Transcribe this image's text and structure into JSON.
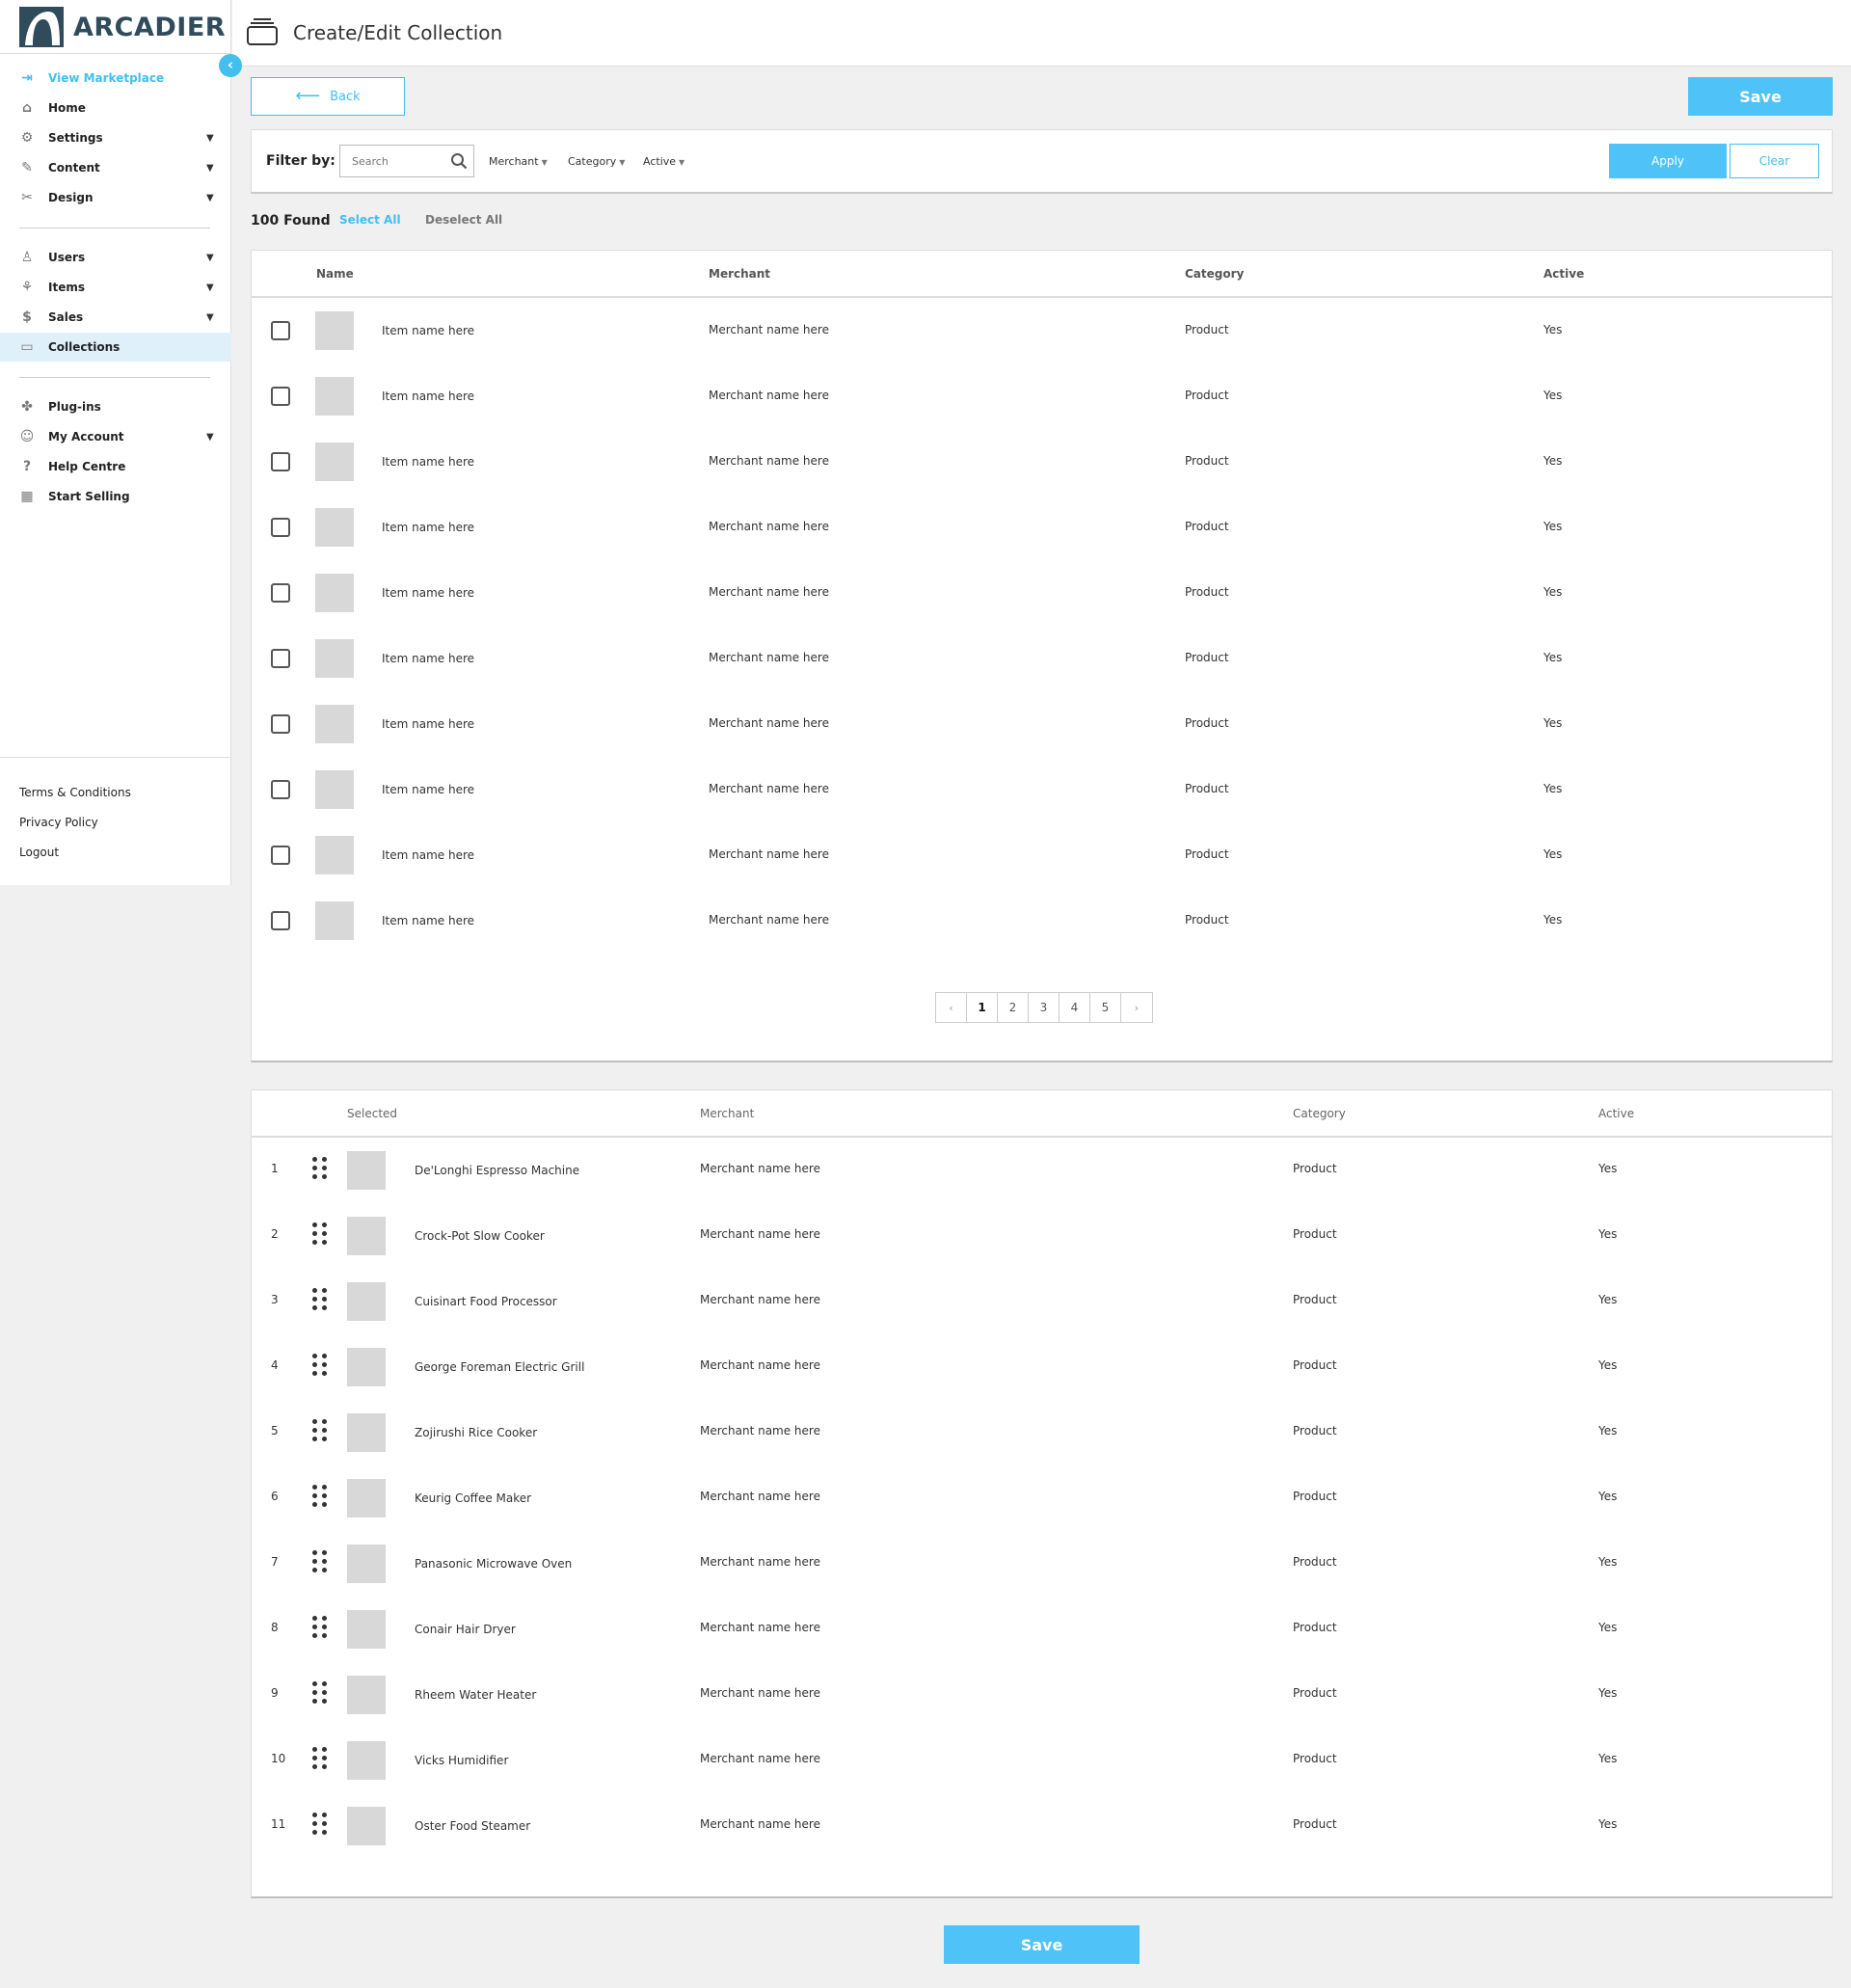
{
  "brand": {
    "name": "ARCADIER"
  },
  "sidebar": {
    "top_items": [
      {
        "label": "View Marketplace",
        "icon": "enter-icon",
        "expandable": false
      },
      {
        "label": "Home",
        "icon": "home-icon",
        "expandable": false
      },
      {
        "label": "Settings",
        "icon": "gear-icon",
        "expandable": true
      },
      {
        "label": "Content",
        "icon": "content-icon",
        "expandable": true
      },
      {
        "label": "Design",
        "icon": "design-icon",
        "expandable": true
      }
    ],
    "mid_items": [
      {
        "label": "Users",
        "icon": "user-icon",
        "expandable": true
      },
      {
        "label": "Items",
        "icon": "items-icon",
        "expandable": true
      },
      {
        "label": "Sales",
        "icon": "dollar-icon",
        "expandable": true
      },
      {
        "label": "Collections",
        "icon": "collection-icon",
        "expandable": false,
        "active": true
      }
    ],
    "bottom_items": [
      {
        "label": "Plug-ins",
        "icon": "puzzle-icon",
        "expandable": false
      },
      {
        "label": "My Account",
        "icon": "account-icon",
        "expandable": true
      },
      {
        "label": "Help Centre",
        "icon": "help-icon",
        "expandable": false
      },
      {
        "label": "Start Selling",
        "icon": "store-icon",
        "expandable": false
      }
    ],
    "footer_links": [
      "Terms & Conditions",
      "Privacy Policy",
      "Logout"
    ]
  },
  "header": {
    "title": "Create/Edit Collection"
  },
  "actions": {
    "back_label": "Back",
    "save_label": "Save",
    "bottom_save_label": "Save"
  },
  "filter": {
    "label": "Filter by:",
    "search_placeholder": "Search",
    "dropdowns": [
      "Merchant",
      "Category",
      "Active"
    ],
    "apply_label": "Apply",
    "clear_label": "Clear"
  },
  "results": {
    "found": "100 Found",
    "select_all": "Select All",
    "deselect_all": "Deselect All"
  },
  "items_table": {
    "columns": [
      "Name",
      "Merchant",
      "Category",
      "Active"
    ],
    "rows": [
      {
        "name": "Item name here",
        "merchant": "Merchant name here",
        "category": "Product",
        "active": "Yes"
      },
      {
        "name": "Item name here",
        "merchant": "Merchant name here",
        "category": "Product",
        "active": "Yes"
      },
      {
        "name": "Item name here",
        "merchant": "Merchant name here",
        "category": "Product",
        "active": "Yes"
      },
      {
        "name": "Item name here",
        "merchant": "Merchant name here",
        "category": "Product",
        "active": "Yes"
      },
      {
        "name": "Item name here",
        "merchant": "Merchant name here",
        "category": "Product",
        "active": "Yes"
      },
      {
        "name": "Item name here",
        "merchant": "Merchant name here",
        "category": "Product",
        "active": "Yes"
      },
      {
        "name": "Item name here",
        "merchant": "Merchant name here",
        "category": "Product",
        "active": "Yes"
      },
      {
        "name": "Item name here",
        "merchant": "Merchant name here",
        "category": "Product",
        "active": "Yes"
      },
      {
        "name": "Item name here",
        "merchant": "Merchant name here",
        "category": "Product",
        "active": "Yes"
      },
      {
        "name": "Item name here",
        "merchant": "Merchant name here",
        "category": "Product",
        "active": "Yes"
      }
    ]
  },
  "pagination": {
    "prev": "‹",
    "pages": [
      "1",
      "2",
      "3",
      "4",
      "5"
    ],
    "current": "1",
    "next": "›"
  },
  "selected_table": {
    "columns": [
      "Selected",
      "Merchant",
      "Category",
      "Active"
    ],
    "rows": [
      {
        "index": "1",
        "name": "De'Longhi Espresso Machine",
        "merchant": "Merchant name here",
        "category": "Product",
        "active": "Yes"
      },
      {
        "index": "2",
        "name": "Crock-Pot Slow Cooker",
        "merchant": "Merchant name here",
        "category": "Product",
        "active": "Yes"
      },
      {
        "index": "3",
        "name": "Cuisinart Food Processor",
        "merchant": "Merchant name here",
        "category": "Product",
        "active": "Yes"
      },
      {
        "index": "4",
        "name": "George Foreman Electric Grill",
        "merchant": "Merchant name here",
        "category": "Product",
        "active": "Yes"
      },
      {
        "index": "5",
        "name": "Zojirushi Rice Cooker",
        "merchant": "Merchant name here",
        "category": "Product",
        "active": "Yes"
      },
      {
        "index": "6",
        "name": "Keurig Coffee Maker",
        "merchant": "Merchant name here",
        "category": "Product",
        "active": "Yes"
      },
      {
        "index": "7",
        "name": "Panasonic Microwave Oven",
        "merchant": "Merchant name here",
        "category": "Product",
        "active": "Yes"
      },
      {
        "index": "8",
        "name": "Conair Hair Dryer",
        "merchant": "Merchant name here",
        "category": "Product",
        "active": "Yes"
      },
      {
        "index": "9",
        "name": "Rheem Water Heater",
        "merchant": "Merchant name here",
        "category": "Product",
        "active": "Yes"
      },
      {
        "index": "10",
        "name": "Vicks Humidifier",
        "merchant": "Merchant name here",
        "category": "Product",
        "active": "Yes"
      },
      {
        "index": "11",
        "name": "Oster Food Steamer",
        "merchant": "Merchant name here",
        "category": "Product",
        "active": "Yes"
      }
    ]
  },
  "colors": {
    "accent": "#4fc3f7",
    "link": "#42bfef",
    "brand": "#2f4b5c",
    "active_nav_bg": "#dff0fb"
  }
}
